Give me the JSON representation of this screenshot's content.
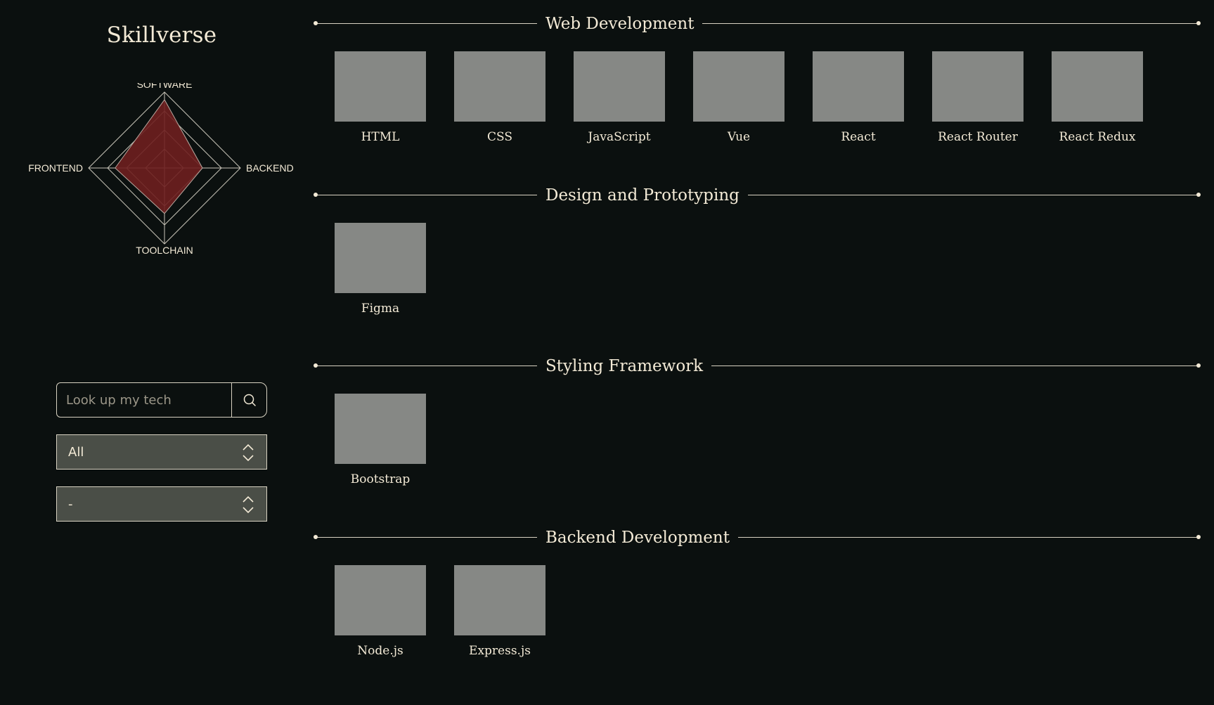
{
  "brand": {
    "title": "Skillverse"
  },
  "radar": {
    "axes": [
      "SOFTWARE",
      "BACKEND",
      "TOOLCHAIN",
      "FRONTEND"
    ],
    "values": [
      0.9,
      0.5,
      0.6,
      0.65
    ],
    "fill_color": "#6e1f1f",
    "stroke_color": "#c8c4b8"
  },
  "search": {
    "placeholder": "Look up my tech",
    "value": ""
  },
  "filters": {
    "category_selected": "All",
    "sort_selected": "-"
  },
  "categories": [
    {
      "title": "Web Development",
      "skills": [
        "HTML",
        "CSS",
        "JavaScript",
        "Vue",
        "React",
        "React Router",
        "React Redux"
      ]
    },
    {
      "title": "Design and Prototyping",
      "skills": [
        "Figma"
      ]
    },
    {
      "title": "Styling Framework",
      "skills": [
        "Bootstrap"
      ]
    },
    {
      "title": "Backend Development",
      "skills": [
        "Node.js",
        "Express.js"
      ]
    }
  ],
  "colors": {
    "background": "#0b100f",
    "text": "#f3ead6",
    "tile": "#868885",
    "select_bg": "#4a4e47"
  }
}
